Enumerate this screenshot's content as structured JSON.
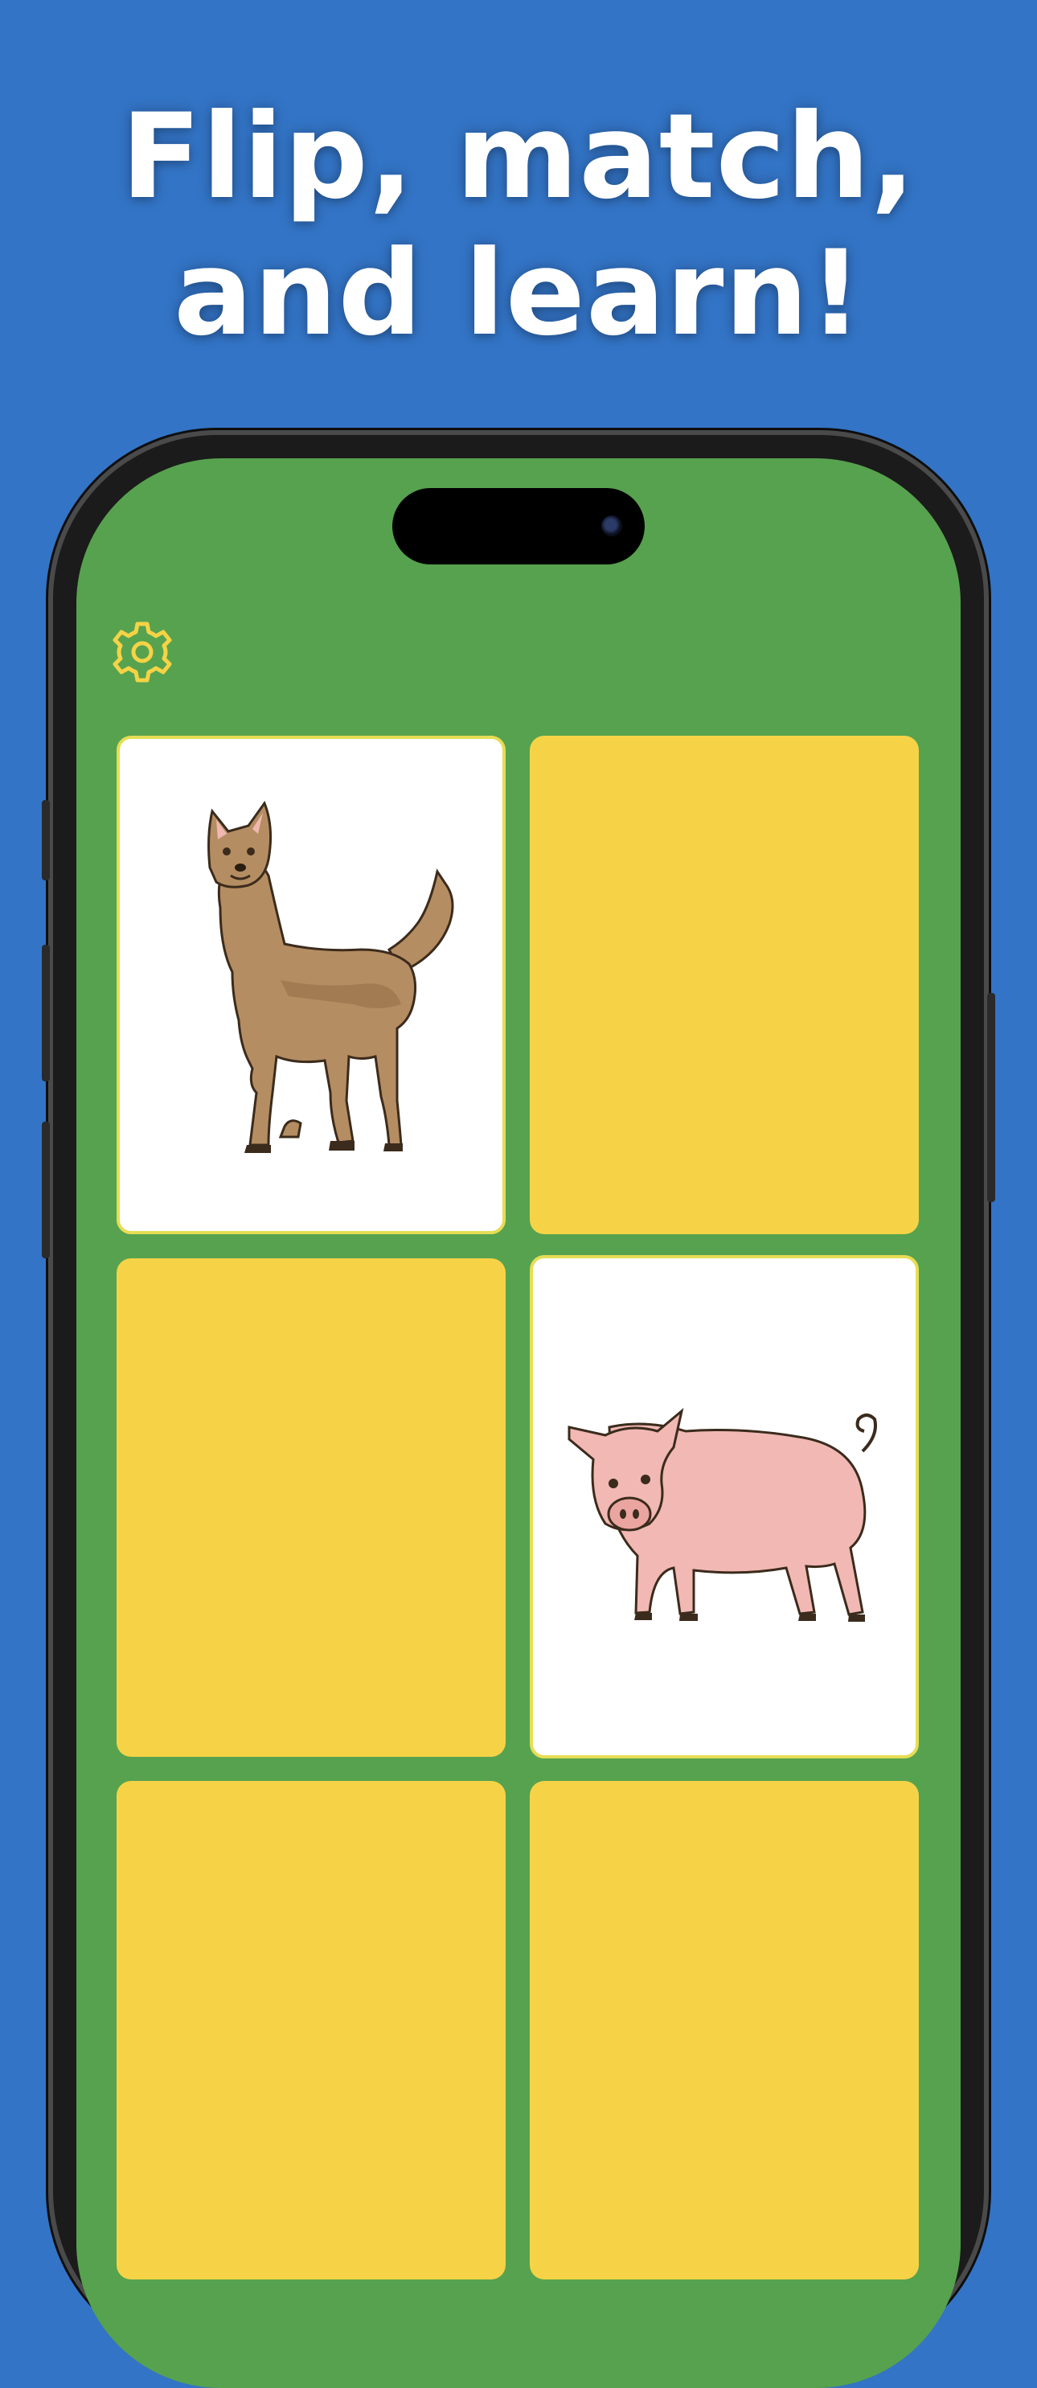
{
  "headline": {
    "line1": "Flip, match,",
    "line2": "and learn!"
  },
  "app": {
    "settings_icon": "gear-icon",
    "colors": {
      "background": "#3374c6",
      "screen": "#57a24e",
      "card_back": "#f6d346",
      "card_face": "#ffffff",
      "gear": "#f6d346"
    }
  },
  "cards": [
    {
      "row": 1,
      "col": 1,
      "state": "face-up",
      "animal": "dog"
    },
    {
      "row": 1,
      "col": 2,
      "state": "face-down"
    },
    {
      "row": 2,
      "col": 1,
      "state": "face-down"
    },
    {
      "row": 2,
      "col": 2,
      "state": "face-up",
      "animal": "pig"
    },
    {
      "row": 3,
      "col": 1,
      "state": "face-down"
    },
    {
      "row": 3,
      "col": 2,
      "state": "face-down"
    }
  ]
}
